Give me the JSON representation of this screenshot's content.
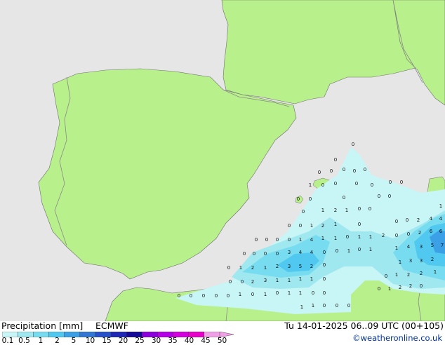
{
  "title": "Precipitation [mm]",
  "model": "ECMWF",
  "valid_time": "Tu 14-01-2025 06..09 UTC (00+105)",
  "credit": "©weatheronline.co.uk",
  "colors": {
    "sea": "#e6e6e6",
    "land": "#b8f08c",
    "border": "#8a8a8a",
    "coast": "#6e6e6e"
  },
  "legend": {
    "ticks": [
      "0.1",
      "0.5",
      "1",
      "2",
      "5",
      "10",
      "15",
      "20",
      "25",
      "30",
      "35",
      "40",
      "45",
      "50"
    ],
    "colors": [
      "#c8f5f5",
      "#a0e8f0",
      "#78dcf0",
      "#50c8f0",
      "#3ca0e6",
      "#3278d2",
      "#2850c8",
      "#1e28b4",
      "#140a96",
      "#8c00dc",
      "#b400e6",
      "#d200dc",
      "#e600c8",
      "#f0a0e6"
    ]
  },
  "values": {
    "high": [
      "0",
      "1",
      "2",
      "3",
      "5",
      "6",
      "7"
    ]
  }
}
